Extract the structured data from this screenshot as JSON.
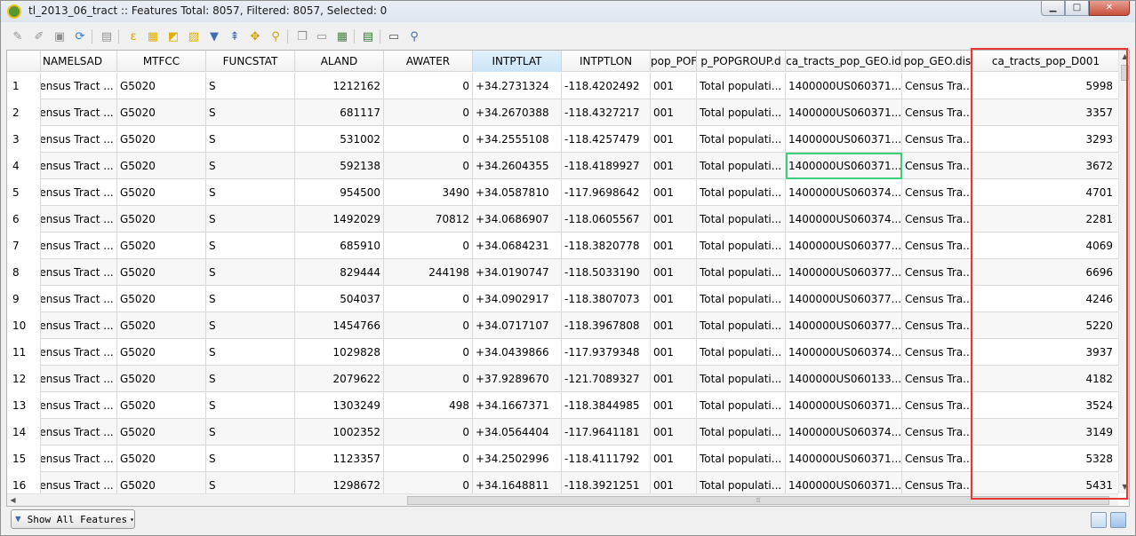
{
  "window": {
    "title": "tl_2013_06_tract :: Features Total: 8057, Filtered: 8057, Selected: 0",
    "min_label": "▁",
    "max_label": "□",
    "close_label": "✕"
  },
  "toolbar": {
    "icons": [
      "pencil-icon",
      "save-edits-icon",
      "save-icon",
      "reload-icon",
      "delete-icon",
      "select-by-expression-icon",
      "select-all-icon",
      "invert-selection-icon",
      "deselect-all-icon",
      "filter-icon",
      "move-selection-to-top-icon",
      "pan-to-selection-icon",
      "zoom-to-selection-icon",
      "copy-icon",
      "paste-icon",
      "new-field-icon",
      "delete-field-icon",
      "field-calculator-icon",
      "conditional-formatting-icon",
      "dock-icon",
      "zoom-icon"
    ]
  },
  "columns": [
    "NAMELSAD",
    "MTFCC",
    "FUNCSTAT",
    "ALAND",
    "AWATER",
    "INTPTLAT",
    "INTPTLON",
    "pop_POP",
    "pop_POPGROUP.d",
    "ca_tracts_pop_GEO.id",
    "pop_GEO.dis",
    "ca_tracts_pop_D001"
  ],
  "column_display": [
    "NAMELSAD",
    "MTFCC",
    "FUNCSTAT",
    "ALAND",
    "AWATER",
    "INTPTLAT",
    "INTPTLON",
    "pop_POF",
    "p_POPGROUP.d",
    "ca_tracts_pop_GEO.id",
    "pop_GEO.dis",
    "ca_tracts_pop_D001"
  ],
  "selected_column": "INTPTLAT",
  "highlighted_column": "ca_tracts_pop_D001",
  "current_cell": {
    "row": 4,
    "column": "ca_tracts_pop_GEO.id"
  },
  "rows": [
    {
      "n": "1",
      "namelsad": "Census Tract ...",
      "mtfcc": "G5020",
      "funcstat": "S",
      "aland": "1212162",
      "awater": "0",
      "intptlat": "+34.2731324",
      "intptlon": "-118.4202492",
      "pop": "001",
      "popgroup": "Total populati...",
      "geoid": "1400000US060371...",
      "geodis": "Census Tra...",
      "d001": "5998"
    },
    {
      "n": "2",
      "namelsad": "Census Tract ...",
      "mtfcc": "G5020",
      "funcstat": "S",
      "aland": "681117",
      "awater": "0",
      "intptlat": "+34.2670388",
      "intptlon": "-118.4327217",
      "pop": "001",
      "popgroup": "Total populati...",
      "geoid": "1400000US060371...",
      "geodis": "Census Tra...",
      "d001": "3357"
    },
    {
      "n": "3",
      "namelsad": "Census Tract ...",
      "mtfcc": "G5020",
      "funcstat": "S",
      "aland": "531002",
      "awater": "0",
      "intptlat": "+34.2555108",
      "intptlon": "-118.4257479",
      "pop": "001",
      "popgroup": "Total populati...",
      "geoid": "1400000US060371...",
      "geodis": "Census Tra...",
      "d001": "3293"
    },
    {
      "n": "4",
      "namelsad": "Census Tract ...",
      "mtfcc": "G5020",
      "funcstat": "S",
      "aland": "592138",
      "awater": "0",
      "intptlat": "+34.2604355",
      "intptlon": "-118.4189927",
      "pop": "001",
      "popgroup": "Total populati...",
      "geoid": "1400000US060371...",
      "geodis": "Census Tra...",
      "d001": "3672"
    },
    {
      "n": "5",
      "namelsad": "Census Tract ...",
      "mtfcc": "G5020",
      "funcstat": "S",
      "aland": "954500",
      "awater": "3490",
      "intptlat": "+34.0587810",
      "intptlon": "-117.9698642",
      "pop": "001",
      "popgroup": "Total populati...",
      "geoid": "1400000US060374...",
      "geodis": "Census Tra...",
      "d001": "4701"
    },
    {
      "n": "6",
      "namelsad": "Census Tract ...",
      "mtfcc": "G5020",
      "funcstat": "S",
      "aland": "1492029",
      "awater": "70812",
      "intptlat": "+34.0686907",
      "intptlon": "-118.0605567",
      "pop": "001",
      "popgroup": "Total populati...",
      "geoid": "1400000US060374...",
      "geodis": "Census Tra...",
      "d001": "2281"
    },
    {
      "n": "7",
      "namelsad": "Census Tract ...",
      "mtfcc": "G5020",
      "funcstat": "S",
      "aland": "685910",
      "awater": "0",
      "intptlat": "+34.0684231",
      "intptlon": "-118.3820778",
      "pop": "001",
      "popgroup": "Total populati...",
      "geoid": "1400000US060377...",
      "geodis": "Census Tra...",
      "d001": "4069"
    },
    {
      "n": "8",
      "namelsad": "Census Tract ...",
      "mtfcc": "G5020",
      "funcstat": "S",
      "aland": "829444",
      "awater": "244198",
      "intptlat": "+34.0190747",
      "intptlon": "-118.5033190",
      "pop": "001",
      "popgroup": "Total populati...",
      "geoid": "1400000US060377...",
      "geodis": "Census Tra...",
      "d001": "6696"
    },
    {
      "n": "9",
      "namelsad": "Census Tract ...",
      "mtfcc": "G5020",
      "funcstat": "S",
      "aland": "504037",
      "awater": "0",
      "intptlat": "+34.0902917",
      "intptlon": "-118.3807073",
      "pop": "001",
      "popgroup": "Total populati...",
      "geoid": "1400000US060377...",
      "geodis": "Census Tra...",
      "d001": "4246"
    },
    {
      "n": "10",
      "namelsad": "Census Tract ...",
      "mtfcc": "G5020",
      "funcstat": "S",
      "aland": "1454766",
      "awater": "0",
      "intptlat": "+34.0717107",
      "intptlon": "-118.3967808",
      "pop": "001",
      "popgroup": "Total populati...",
      "geoid": "1400000US060377...",
      "geodis": "Census Tra...",
      "d001": "5220"
    },
    {
      "n": "11",
      "namelsad": "Census Tract ...",
      "mtfcc": "G5020",
      "funcstat": "S",
      "aland": "1029828",
      "awater": "0",
      "intptlat": "+34.0439866",
      "intptlon": "-117.9379348",
      "pop": "001",
      "popgroup": "Total populati...",
      "geoid": "1400000US060374...",
      "geodis": "Census Tra...",
      "d001": "3937"
    },
    {
      "n": "12",
      "namelsad": "Census Tract ...",
      "mtfcc": "G5020",
      "funcstat": "S",
      "aland": "2079622",
      "awater": "0",
      "intptlat": "+37.9289670",
      "intptlon": "-121.7089327",
      "pop": "001",
      "popgroup": "Total populati...",
      "geoid": "1400000US060133...",
      "geodis": "Census Tra...",
      "d001": "4182"
    },
    {
      "n": "13",
      "namelsad": "Census Tract ...",
      "mtfcc": "G5020",
      "funcstat": "S",
      "aland": "1303249",
      "awater": "498",
      "intptlat": "+34.1667371",
      "intptlon": "-118.3844985",
      "pop": "001",
      "popgroup": "Total populati...",
      "geoid": "1400000US060371...",
      "geodis": "Census Tra...",
      "d001": "3524"
    },
    {
      "n": "14",
      "namelsad": "Census Tract ...",
      "mtfcc": "G5020",
      "funcstat": "S",
      "aland": "1002352",
      "awater": "0",
      "intptlat": "+34.0564404",
      "intptlon": "-117.9641181",
      "pop": "001",
      "popgroup": "Total populati...",
      "geoid": "1400000US060374...",
      "geodis": "Census Tra...",
      "d001": "3149"
    },
    {
      "n": "15",
      "namelsad": "Census Tract ...",
      "mtfcc": "G5020",
      "funcstat": "S",
      "aland": "1123357",
      "awater": "0",
      "intptlat": "+34.2502996",
      "intptlon": "-118.4111792",
      "pop": "001",
      "popgroup": "Total populati...",
      "geoid": "1400000US060371...",
      "geodis": "Census Tra...",
      "d001": "5328"
    },
    {
      "n": "16",
      "namelsad": "Census Tract ...",
      "mtfcc": "G5020",
      "funcstat": "S",
      "aland": "1298672",
      "awater": "0",
      "intptlat": "+34.1648811",
      "intptlon": "-118.3921251",
      "pop": "001",
      "popgroup": "Total populati...",
      "geoid": "1400000US060371...",
      "geodis": "Census Tra...",
      "d001": "5431"
    }
  ],
  "footer": {
    "show_all_label": "Show All Features"
  },
  "colors": {
    "highlight_border": "#e53935",
    "current_cell": "#3ccf7e",
    "selected_header": "#cbe4f6"
  }
}
